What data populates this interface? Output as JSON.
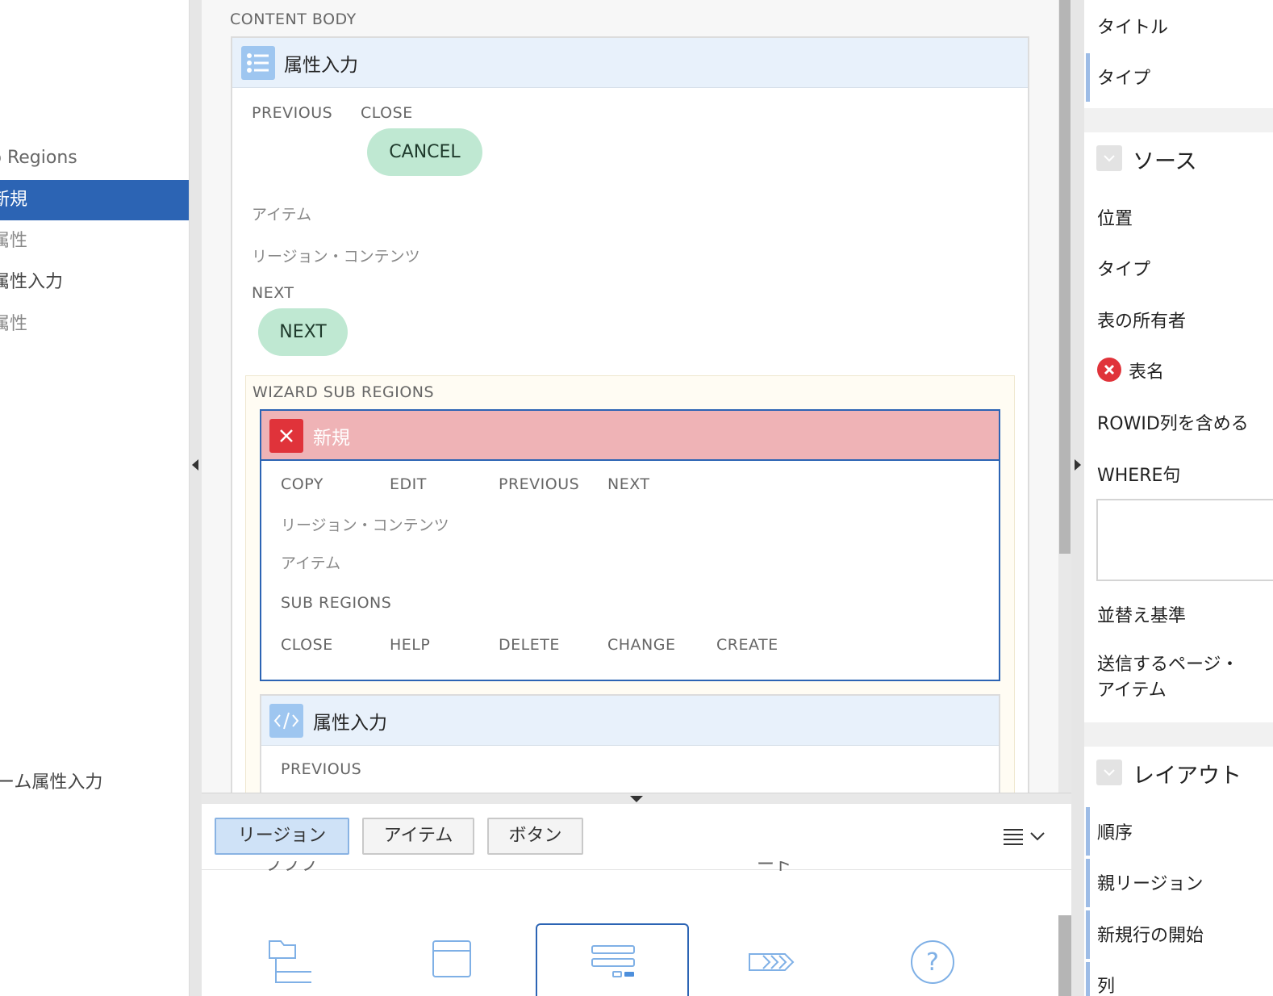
{
  "tree": {
    "items": [
      {
        "label": "p Regions",
        "state": "normal"
      },
      {
        "label": "新規",
        "state": "selected"
      },
      {
        "label": "属性",
        "state": "dim"
      },
      {
        "label": "属性入力",
        "state": "normal"
      },
      {
        "label": "属性",
        "state": "dim"
      },
      {
        "label": "ーム属性入力",
        "state": "normal"
      }
    ]
  },
  "content": {
    "body_label": "CONTENT BODY",
    "region1": {
      "title": "属性入力",
      "icon": "list-icon",
      "previous_label": "PREVIOUS",
      "close_label": "CLOSE",
      "cancel_button": "CANCEL",
      "items_label": "アイテム",
      "region_contents_label": "リージョン・コンテンツ",
      "next_label": "NEXT",
      "next_button": "NEXT"
    },
    "wizard": {
      "label": "WIZARD SUB REGIONS",
      "new_region": {
        "title": "新規",
        "icon": "error-x-icon",
        "row1": [
          "COPY",
          "EDIT",
          "PREVIOUS",
          "NEXT"
        ],
        "region_contents_label": "リージョン・コンテンツ",
        "items_label": "アイテム",
        "sub_regions_label": "SUB REGIONS",
        "row2": [
          "CLOSE",
          "HELP",
          "DELETE",
          "CHANGE",
          "CREATE"
        ]
      },
      "attr_region": {
        "title": "属性入力",
        "icon": "code-icon",
        "previous_label": "PREVIOUS"
      }
    }
  },
  "gallery": {
    "tabs": [
      {
        "label": "リージョン",
        "active": true
      },
      {
        "label": "アイテム",
        "active": false
      },
      {
        "label": "ボタン",
        "active": false
      }
    ],
    "menu_icon": "menu-chevron-icon",
    "cut_labels": [
      "ブブブ",
      "ード"
    ],
    "icons": [
      "tree-icon",
      "window-icon",
      "form-icon",
      "wizard-steps-icon",
      "help-icon"
    ]
  },
  "properties": {
    "top": [
      "タイトル",
      "タイプ"
    ],
    "source": {
      "title": "ソース",
      "fields": [
        "位置",
        "タイプ",
        "表の所有者",
        "表名",
        "ROWID列を含める",
        "WHERE句",
        "並替え基準",
        "送信するページ・\nアイテム"
      ]
    },
    "layout": {
      "title": "レイアウト",
      "fields": [
        "順序",
        "親リージョン",
        "新規行の開始",
        "列"
      ]
    },
    "colors": {
      "error": "#e0333a",
      "accent": "#2c64b4",
      "button_green": "#bfe8d2"
    }
  }
}
